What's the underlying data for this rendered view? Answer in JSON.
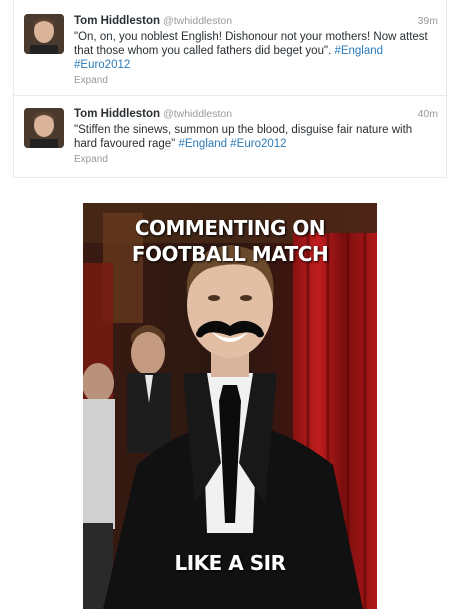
{
  "tweets": [
    {
      "fullname": "Tom Hiddleston",
      "username": "@twhiddleston",
      "time": "39m",
      "text": "\"On, on, you noblest English! Dishonour not your mothers! Now attest that those whom you called fathers did beget you\".",
      "hashtags": [
        "#England",
        "#Euro2012"
      ],
      "expand_label": "Expand"
    },
    {
      "fullname": "Tom Hiddleston",
      "username": "@twhiddleston",
      "time": "40m",
      "text": "\"Stiffen the sinews, summon up the blood, disguise fair nature with hard favoured rage\"",
      "hashtags": [
        "#England",
        "#Euro2012"
      ],
      "expand_label": "Expand"
    }
  ],
  "meme": {
    "top_line_1": "COMMENTING ON",
    "top_line_2": "FOOTBALL MATCH",
    "bottom_text": "LIKE A SIR"
  },
  "colors": {
    "hashtag": "#2b7bb9",
    "meta_gray": "#999999",
    "text": "#292f33"
  }
}
